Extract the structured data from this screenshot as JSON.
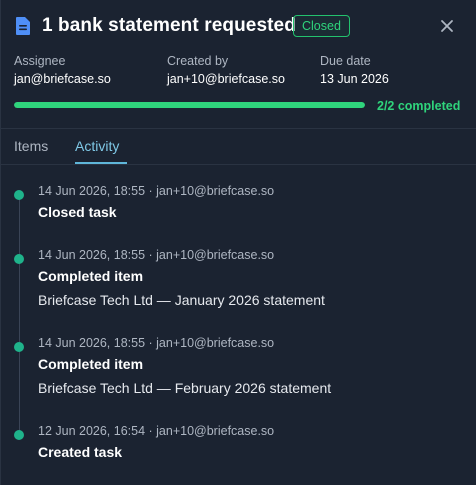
{
  "header": {
    "title": "1 bank statement requested",
    "status_badge": "Closed",
    "close_icon": "close-icon",
    "doc_icon": "document-icon"
  },
  "meta": {
    "assignee_label": "Assignee",
    "assignee_value": "jan@briefcase.so",
    "created_by_label": "Created by",
    "created_by_value": "jan+10@briefcase.so",
    "due_date_label": "Due date",
    "due_date_value": "13 Jun 2026"
  },
  "progress": {
    "completed": 2,
    "total": 2,
    "fraction": 1.0,
    "label": "2/2 completed"
  },
  "tabs": [
    {
      "label": "Items",
      "active": false
    },
    {
      "label": "Activity",
      "active": true
    }
  ],
  "activity": [
    {
      "meta": "14 Jun 2026, 18:55 · jan+10@briefcase.so",
      "title": "Closed task",
      "detail": ""
    },
    {
      "meta": "14 Jun 2026, 18:55 · jan+10@briefcase.so",
      "title": "Completed item",
      "detail": "Briefcase Tech Ltd — January 2026 statement"
    },
    {
      "meta": "14 Jun 2026, 18:55 · jan+10@briefcase.so",
      "title": "Completed item",
      "detail": "Briefcase Tech Ltd — February 2026 statement"
    },
    {
      "meta": "12 Jun 2026, 16:54 · jan+10@briefcase.so",
      "title": "Created task",
      "detail": ""
    }
  ],
  "colors": {
    "background": "#1b2331",
    "success": "#2fd47c",
    "accent": "#5fb6d9",
    "timeline_dot": "#1fb38b",
    "doc_icon": "#4f8ff7"
  }
}
